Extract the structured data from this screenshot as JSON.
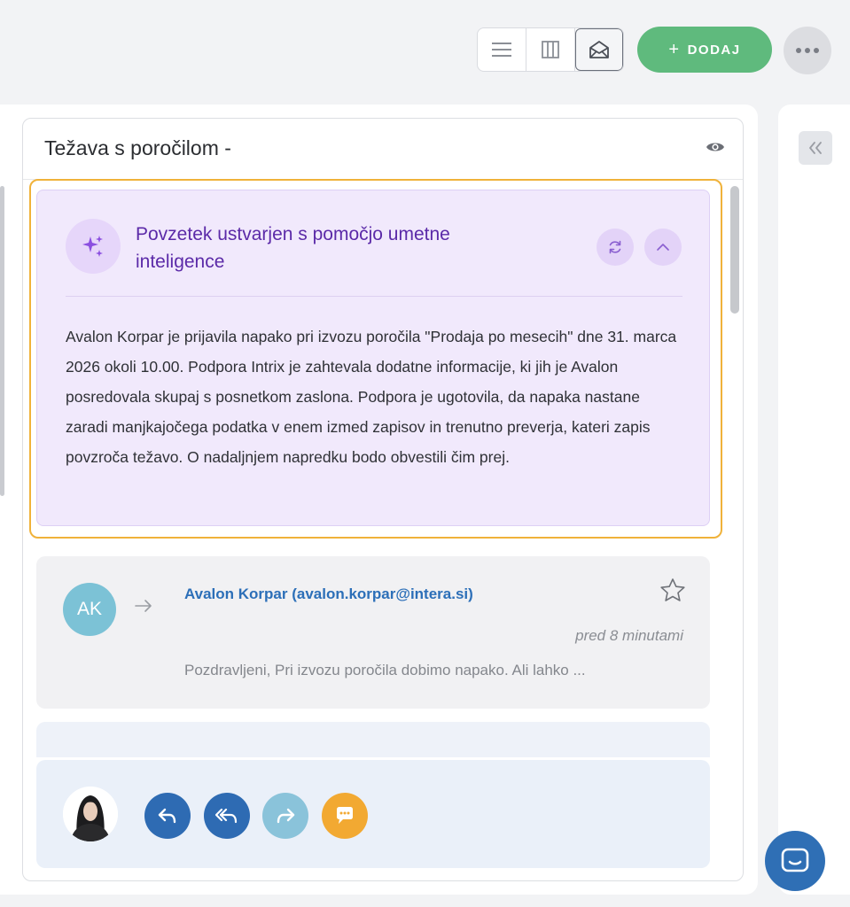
{
  "toolbar": {
    "view_options": [
      "list-view",
      "column-view",
      "inbox-view"
    ],
    "add_label": "DODAJ",
    "add_plus": "+"
  },
  "ticket": {
    "title": "Težava s poročilom -"
  },
  "ai_summary": {
    "title": "Povzetek ustvarjen s pomočjo umetne inteligence",
    "text": "Avalon Korpar je prijavila napako pri izvozu poročila \"Prodaja po mesecih\" dne 31. marca 2026 okoli 10.00. Podpora Intrix je zahtevala dodatne informacije, ki jih je Avalon posredovala skupaj s posnetkom zaslona. Podpora je ugotovila, da napaka nastane zaradi manjkajočega podatka v enem izmed zapisov in trenutno preverja, kateri zapis povzroča težavo. O nadaljnjem napredku bodo obvestili čim prej."
  },
  "message": {
    "avatar_initials": "AK",
    "sender": "Avalon Korpar (avalon.korpar@intera.si)",
    "time": "pred 8 minutami",
    "preview": "Pozdravljeni, Pri izvozu poročila dobimo napako. Ali lahko ..."
  },
  "reply_actions": [
    "reply-icon",
    "reply-all-icon",
    "forward-icon",
    "comment-icon"
  ],
  "colors": {
    "accent_green": "#5fba7d",
    "ai_purple": "#5b2aa8",
    "highlight_orange": "#f0b23a",
    "link_blue": "#2c6fb8"
  }
}
